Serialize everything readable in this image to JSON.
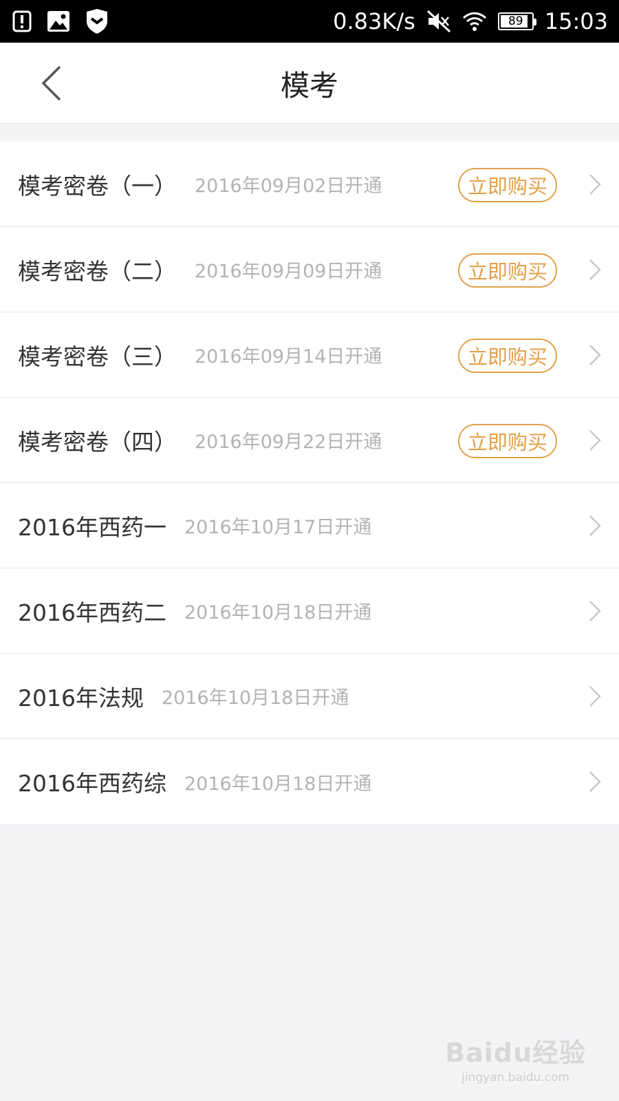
{
  "status_bar": {
    "net_speed": "0.83K/s",
    "battery_level": "89",
    "battery_percent": 89,
    "time": "15:03"
  },
  "nav": {
    "title": "模考"
  },
  "accent_color": "#e2a04a",
  "items": [
    {
      "title": "模考密卷（一）",
      "date": "2016年09月02日开通",
      "button": "立即购买"
    },
    {
      "title": "模考密卷（二）",
      "date": "2016年09月09日开通",
      "button": "立即购买"
    },
    {
      "title": "模考密卷（三）",
      "date": "2016年09月14日开通",
      "button": "立即购买"
    },
    {
      "title": "模考密卷（四）",
      "date": "2016年09月22日开通",
      "button": "立即购买"
    },
    {
      "title": "2016年西药一",
      "date": "2016年10月17日开通"
    },
    {
      "title": "2016年西药二",
      "date": "2016年10月18日开通"
    },
    {
      "title": "2016年法规",
      "date": "2016年10月18日开通"
    },
    {
      "title": "2016年西药综",
      "date": "2016年10月18日开通"
    }
  ],
  "watermark": {
    "logo": "Baidu经验",
    "url": "jingyan.baidu.com"
  }
}
